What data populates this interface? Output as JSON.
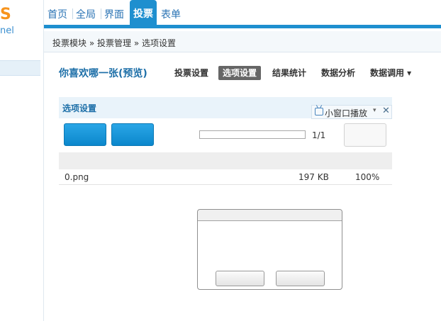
{
  "logo": {
    "top_text": "S",
    "sub_text": "nel"
  },
  "nav": {
    "items": [
      "首页",
      "全局",
      "界面",
      "投票",
      "表单"
    ],
    "active": "投票"
  },
  "breadcrumb": [
    "投票模块",
    "投票管理",
    "选项设置"
  ],
  "breadcrumb_sep": " » ",
  "page": {
    "title": "你喜欢哪一张(预览)",
    "tabs": [
      "投票设置",
      "选项设置",
      "结果统计",
      "数据分析",
      "数据调用 ▾"
    ],
    "active_tab": "选项设置"
  },
  "panel": {
    "title": "选项设置",
    "mini_player": {
      "label": "小窗口播放",
      "caret": "▾",
      "close": "✕"
    }
  },
  "upload": {
    "progress_fraction": 0.0,
    "count": "1/1"
  },
  "files": [
    {
      "name": "0.png",
      "size": "197 KB",
      "percent": "100%"
    }
  ],
  "colors": {
    "accent": "#1e8fcf",
    "title": "#1d6fa8",
    "button": "#0b87cc"
  }
}
